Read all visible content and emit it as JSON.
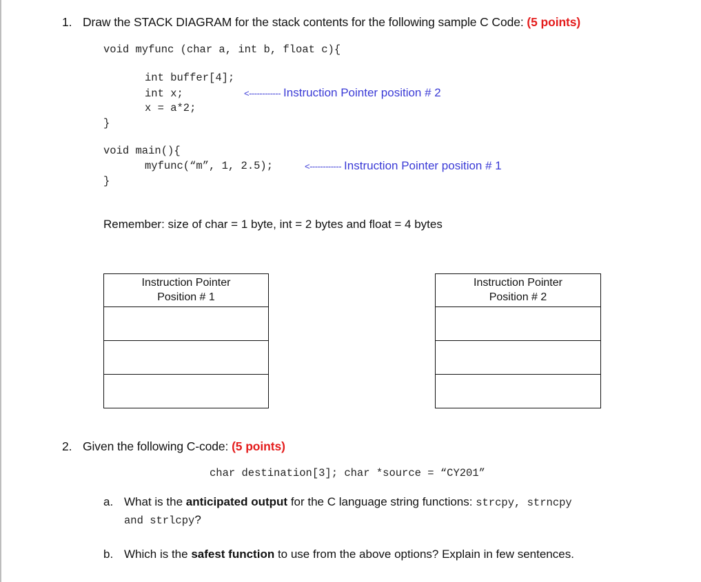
{
  "question1": {
    "number": "1.",
    "prompt": "Draw the STACK DIAGRAM for the stack contents for the following sample C Code:",
    "points": "(5 points)",
    "code": {
      "myfunc_signature": "void myfunc (char a, int b, float c){",
      "myfunc_body": [
        "int buffer[4];",
        "int x;",
        "x = a*2;"
      ],
      "myfunc_close": "}",
      "main_signature": "void main(){",
      "main_body": "myfunc(“m”, 1, 2.5);",
      "main_close": "}"
    },
    "annotations": {
      "arrow": "<------------",
      "ip2": "Instruction Pointer position # 2",
      "ip1": "Instruction Pointer position # 1"
    },
    "reminder": "Remember: size of char = 1 byte, int = 2 bytes and float = 4 bytes",
    "stack_boxes": [
      {
        "header_line1": "Instruction Pointer",
        "header_line2": "Position # 1",
        "slots": [
          "",
          "",
          ""
        ]
      },
      {
        "header_line1": "Instruction Pointer",
        "header_line2": "Position # 2",
        "slots": [
          "",
          "",
          ""
        ]
      }
    ]
  },
  "question2": {
    "number": "2.",
    "prompt": "Given the following C-code:",
    "points": "(5 points)",
    "code": "char destination[3]; char *source = “CY201”",
    "part_a": {
      "label": "a.",
      "text_before": "What is the ",
      "bold": "anticipated output",
      "text_after": " for the C language string functions: ",
      "functions_line1": "strcpy, strncpy",
      "functions_line2": "and strlcpy",
      "end": "?"
    },
    "part_b": {
      "label": "b.",
      "text_before": "Which is the ",
      "bold": "safest function",
      "text_after": " to use from the above options? Explain in few sentences."
    }
  },
  "colors": {
    "points": "#e41c1c",
    "annotation": "#3a3ad6"
  }
}
